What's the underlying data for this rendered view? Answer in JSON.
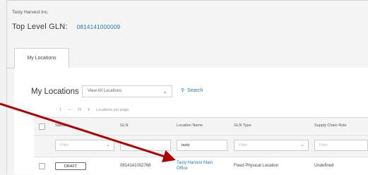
{
  "company_name": "Tasty Harvest Inc.",
  "top_level_gln": {
    "label": "Top Level GLN:",
    "value": "0814141000009"
  },
  "tabs": [
    {
      "label": "My Locations"
    }
  ],
  "section": {
    "title": "My Locations",
    "view_select": {
      "selected": "View All Locations"
    },
    "search_label": "Search"
  },
  "pager": {
    "page": "1",
    "count": "25",
    "per_page_label": "Locations per page"
  },
  "table": {
    "columns": [
      "Status",
      "GLN",
      "Location Name",
      "GLN Type",
      "Supply Chain Role"
    ],
    "filters": {
      "status": "Filter",
      "gln": "Filter",
      "location_name": "tasty",
      "gln_type": "Filter",
      "supply_chain_role": "Filter"
    },
    "rows": [
      {
        "status": "DRAFT",
        "gln": "0814141002768",
        "location_name": "Tasty Harvest Main Office",
        "gln_type": "Fixed Physical Location",
        "supply_chain_role": "Undefined"
      }
    ]
  },
  "colors": {
    "link": "#1f78b4",
    "annotation_arrow": "#b00000"
  },
  "icons": {
    "search": "search-icon",
    "chevron": "chevron-down-icon"
  }
}
